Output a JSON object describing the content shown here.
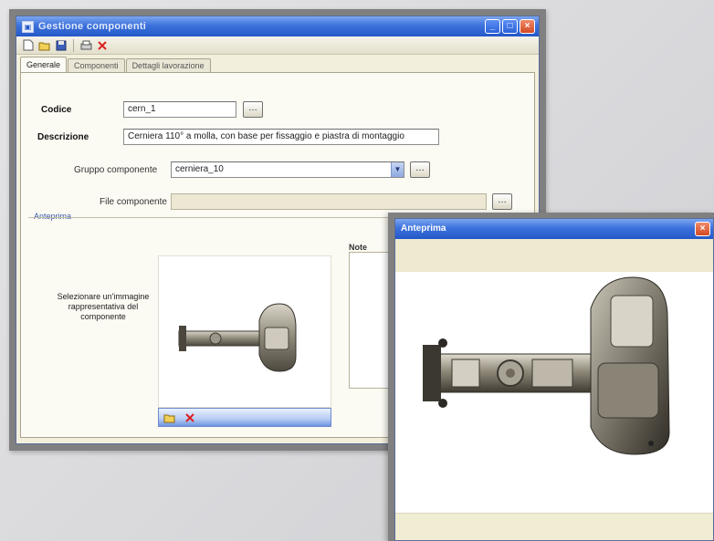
{
  "main_window": {
    "title": "Gestione componenti",
    "tabs": [
      "Generale",
      "Componenti",
      "Dettagli lavorazione"
    ],
    "fields": {
      "codice_label": "Codice",
      "codice_value": "cern_1",
      "descrizione_label": "Descrizione",
      "descrizione_value": "Cerniera 110° a molla, con base per fissaggio e piastra di montaggio",
      "gruppo_label": "Gruppo componente",
      "gruppo_value": "cerniera_10",
      "file_label": "File componente",
      "file_value": ""
    },
    "group_caption": "Anteprima",
    "hint_text": "Selezionare un'immagine rappresentativa del componente",
    "note_label": "Note"
  },
  "preview_window": {
    "title": "Anteprima"
  },
  "icons": {
    "toolbar": [
      "new-icon",
      "open-icon",
      "save-icon",
      "print-icon",
      "delete-icon"
    ],
    "image_toolbar": [
      "load-image-icon",
      "clear-image-icon"
    ]
  }
}
